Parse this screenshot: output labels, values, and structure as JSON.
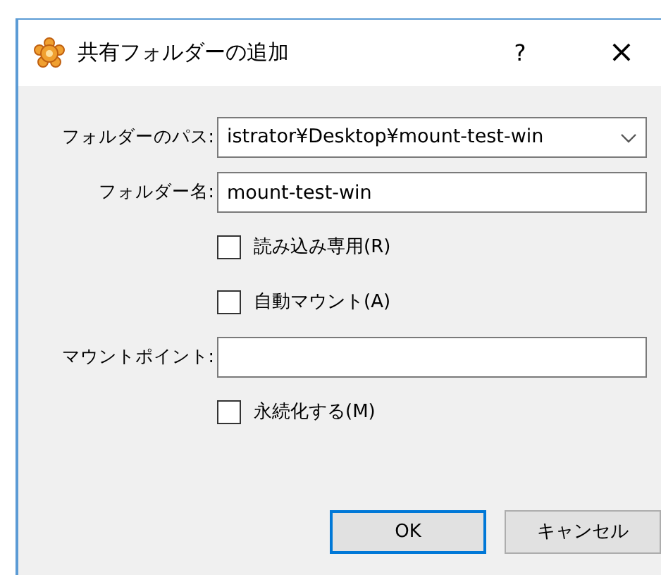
{
  "window": {
    "title": "共有フォルダーの追加",
    "help": "?",
    "close": "×"
  },
  "fields": [
    {
      "kind": "combo",
      "label": "フォルダーのパス:",
      "value": "istrator¥Desktop¥mount-test-win"
    },
    {
      "kind": "text",
      "label": "フォルダー名:",
      "value": "mount-test-win"
    },
    {
      "kind": "check",
      "label": "読み込み専用(R)",
      "checked": false
    },
    {
      "kind": "check",
      "label": "自動マウント(A)",
      "checked": false
    },
    {
      "kind": "text",
      "label": "マウントポイント:"
    },
    {
      "kind": "check",
      "label": "永続化する(M)",
      "checked": false
    }
  ],
  "buttons": [
    {
      "label": "OK",
      "default": true
    },
    {
      "label": "キャンセル",
      "default": false
    }
  ]
}
